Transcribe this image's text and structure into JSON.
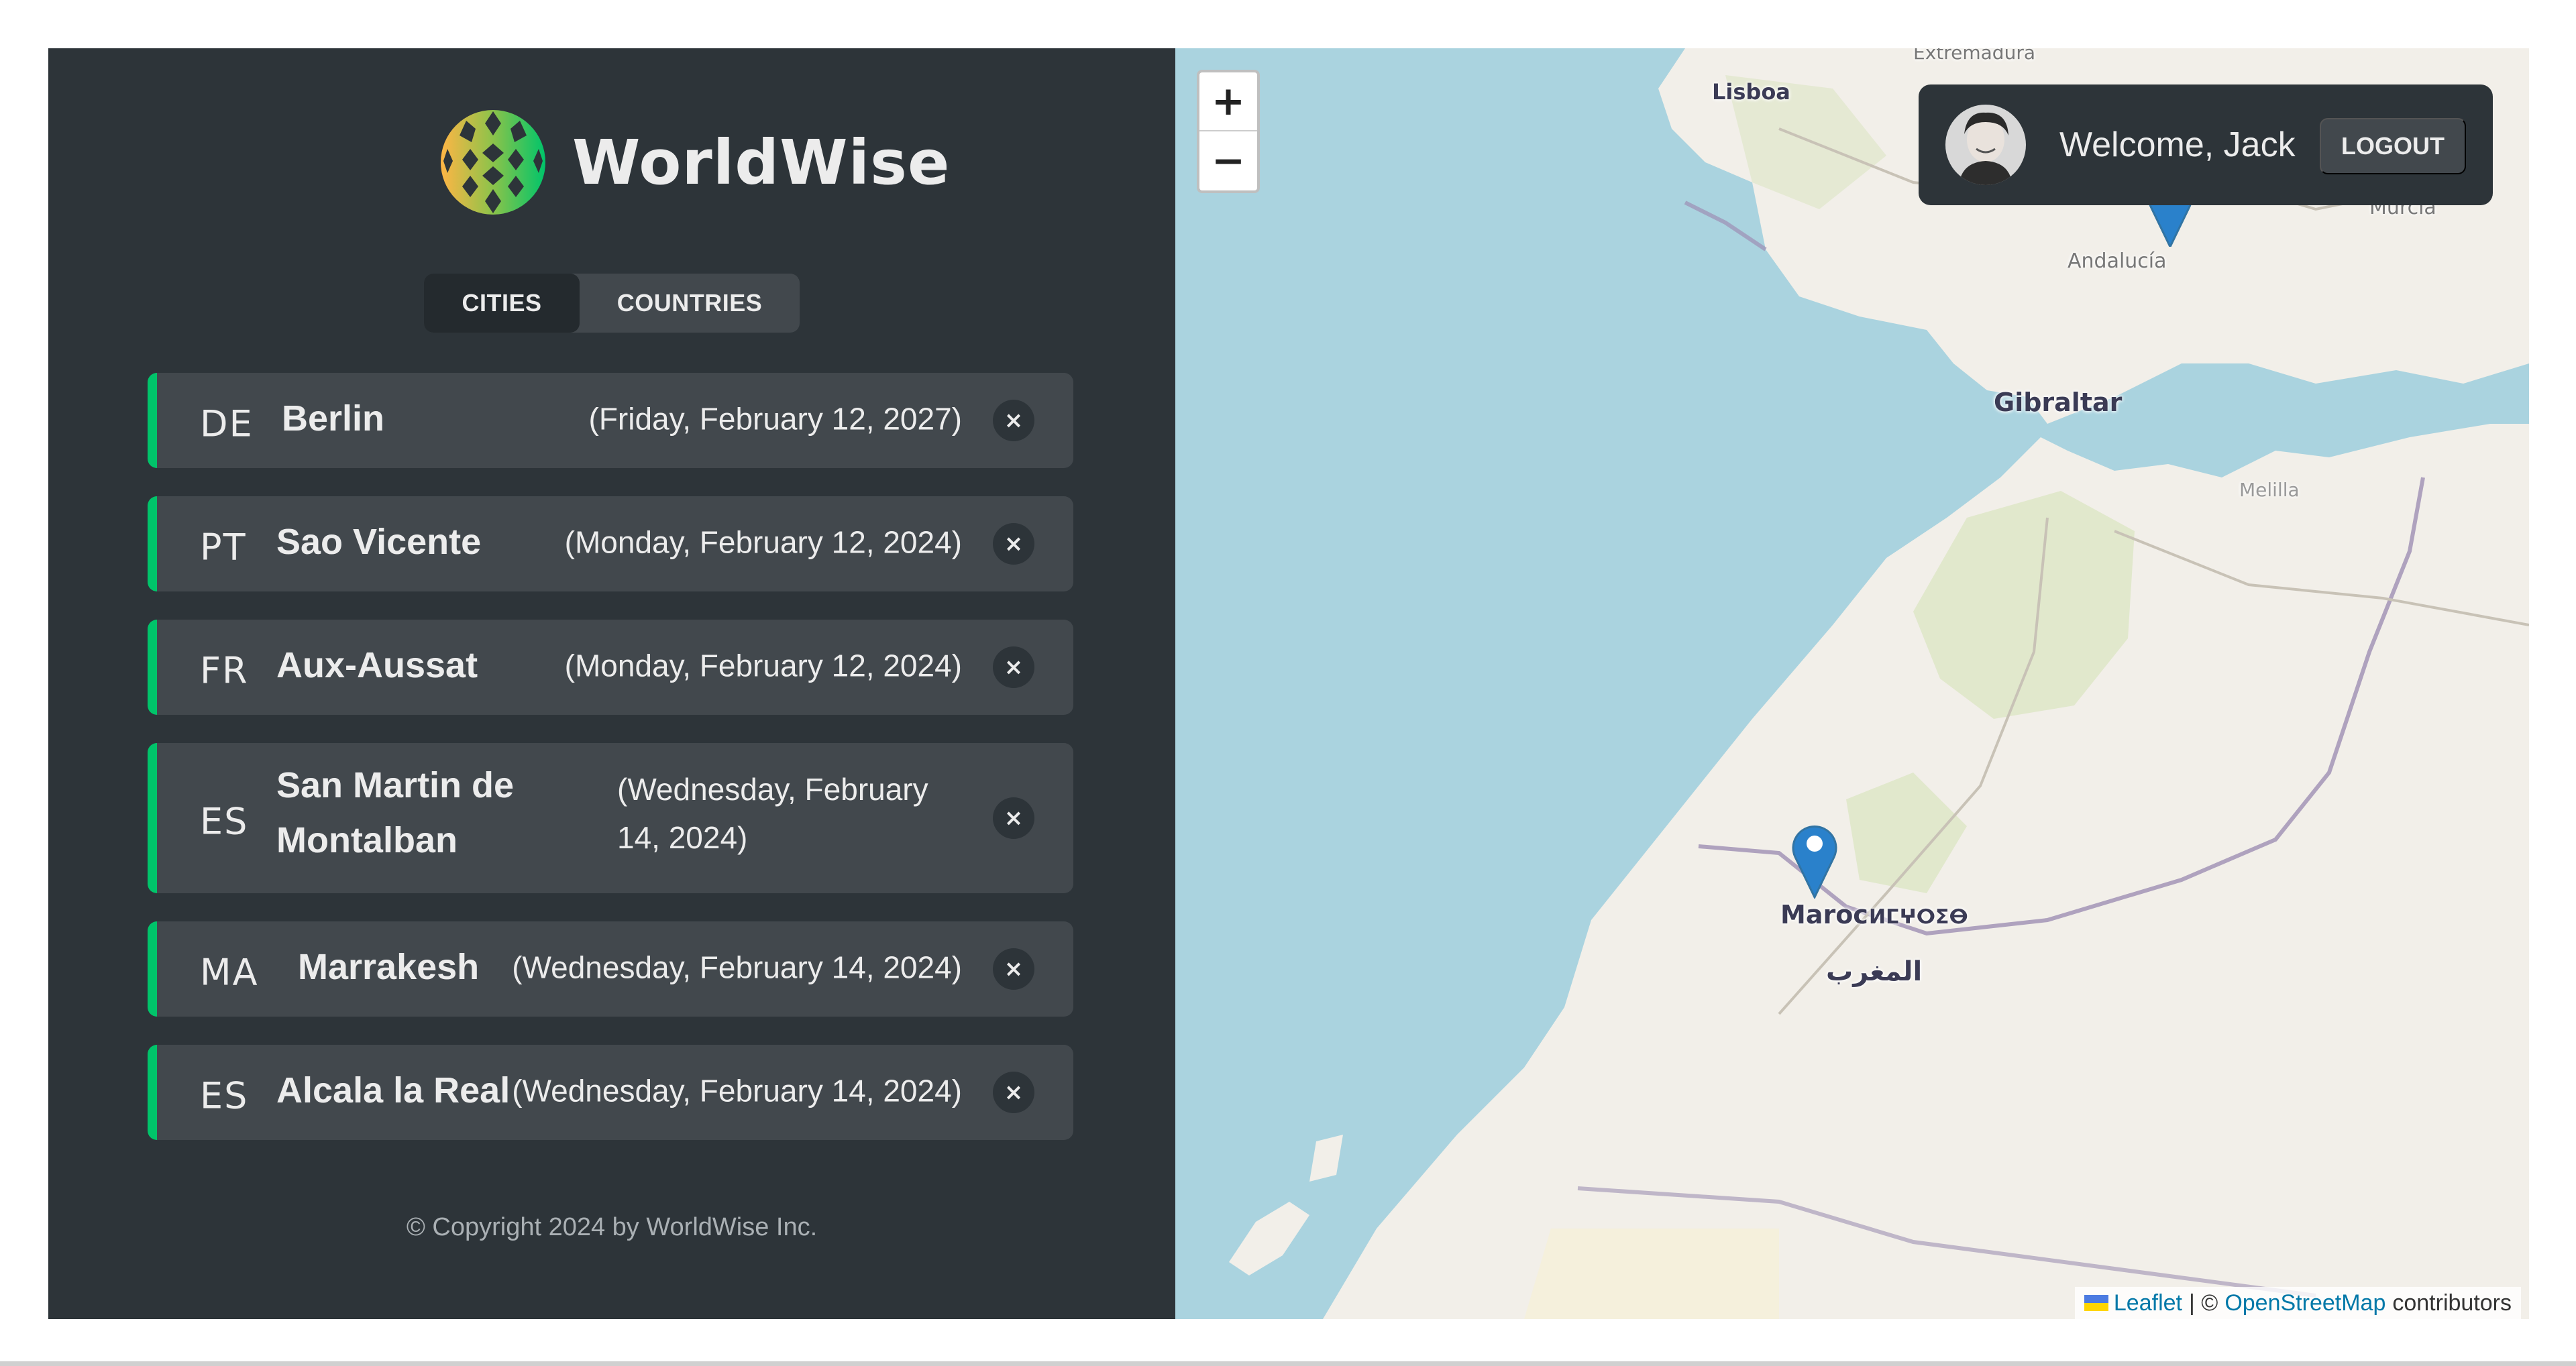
{
  "app": {
    "name": "WorldWise"
  },
  "tabs": [
    {
      "label": "CITIES",
      "active": true
    },
    {
      "label": "COUNTRIES",
      "active": false
    }
  ],
  "cities": [
    {
      "code": "DE",
      "name": "Berlin",
      "date": "(Friday, February 12, 2027)"
    },
    {
      "code": "PT",
      "name": "Sao Vicente",
      "date": "(Monday, February 12, 2024)"
    },
    {
      "code": "FR",
      "name": "Aux-Aussat",
      "date": "(Monday, February 12, 2024)"
    },
    {
      "code": "ES",
      "name": "San Martin de Montalban",
      "date": "(Wednesday, February 14, 2024)"
    },
    {
      "code": "MA",
      "name": "Marrakesh",
      "date": "(Wednesday, February 14, 2024)"
    },
    {
      "code": "ES",
      "name": "Alcala la Real",
      "date": "(Wednesday, February 14, 2024)"
    }
  ],
  "delete_glyph": "×",
  "footer": {
    "copyright": "© Copyright 2024 by WorldWise Inc."
  },
  "user": {
    "welcome": "Welcome, Jack",
    "logout": "LOGOUT"
  },
  "map": {
    "zoom_in": "+",
    "zoom_out": "−",
    "labels": {
      "lisboa": "Lisboa",
      "extremadura": "Extremadura",
      "andalucia": "Andalucía",
      "murcia": "Murcia",
      "gibraltar": "Gibraltar",
      "melilla": "Melilla",
      "maroc": "Maroc",
      "maroc_tifinagh": "ⵍⵎⵖⵔⵉⴱ",
      "maroc_arabic": "المغرب"
    },
    "attribution": {
      "leaflet": "Leaflet",
      "separator": "| ©",
      "osm": "OpenStreetMap",
      "contributors": "contributors"
    }
  },
  "colors": {
    "sidebar_bg": "#2d3439",
    "item_bg": "#42484d",
    "accent_green": "#00c46a",
    "sea": "#aad3df",
    "land": "#f2efe9",
    "marker": "#2a81cb"
  }
}
